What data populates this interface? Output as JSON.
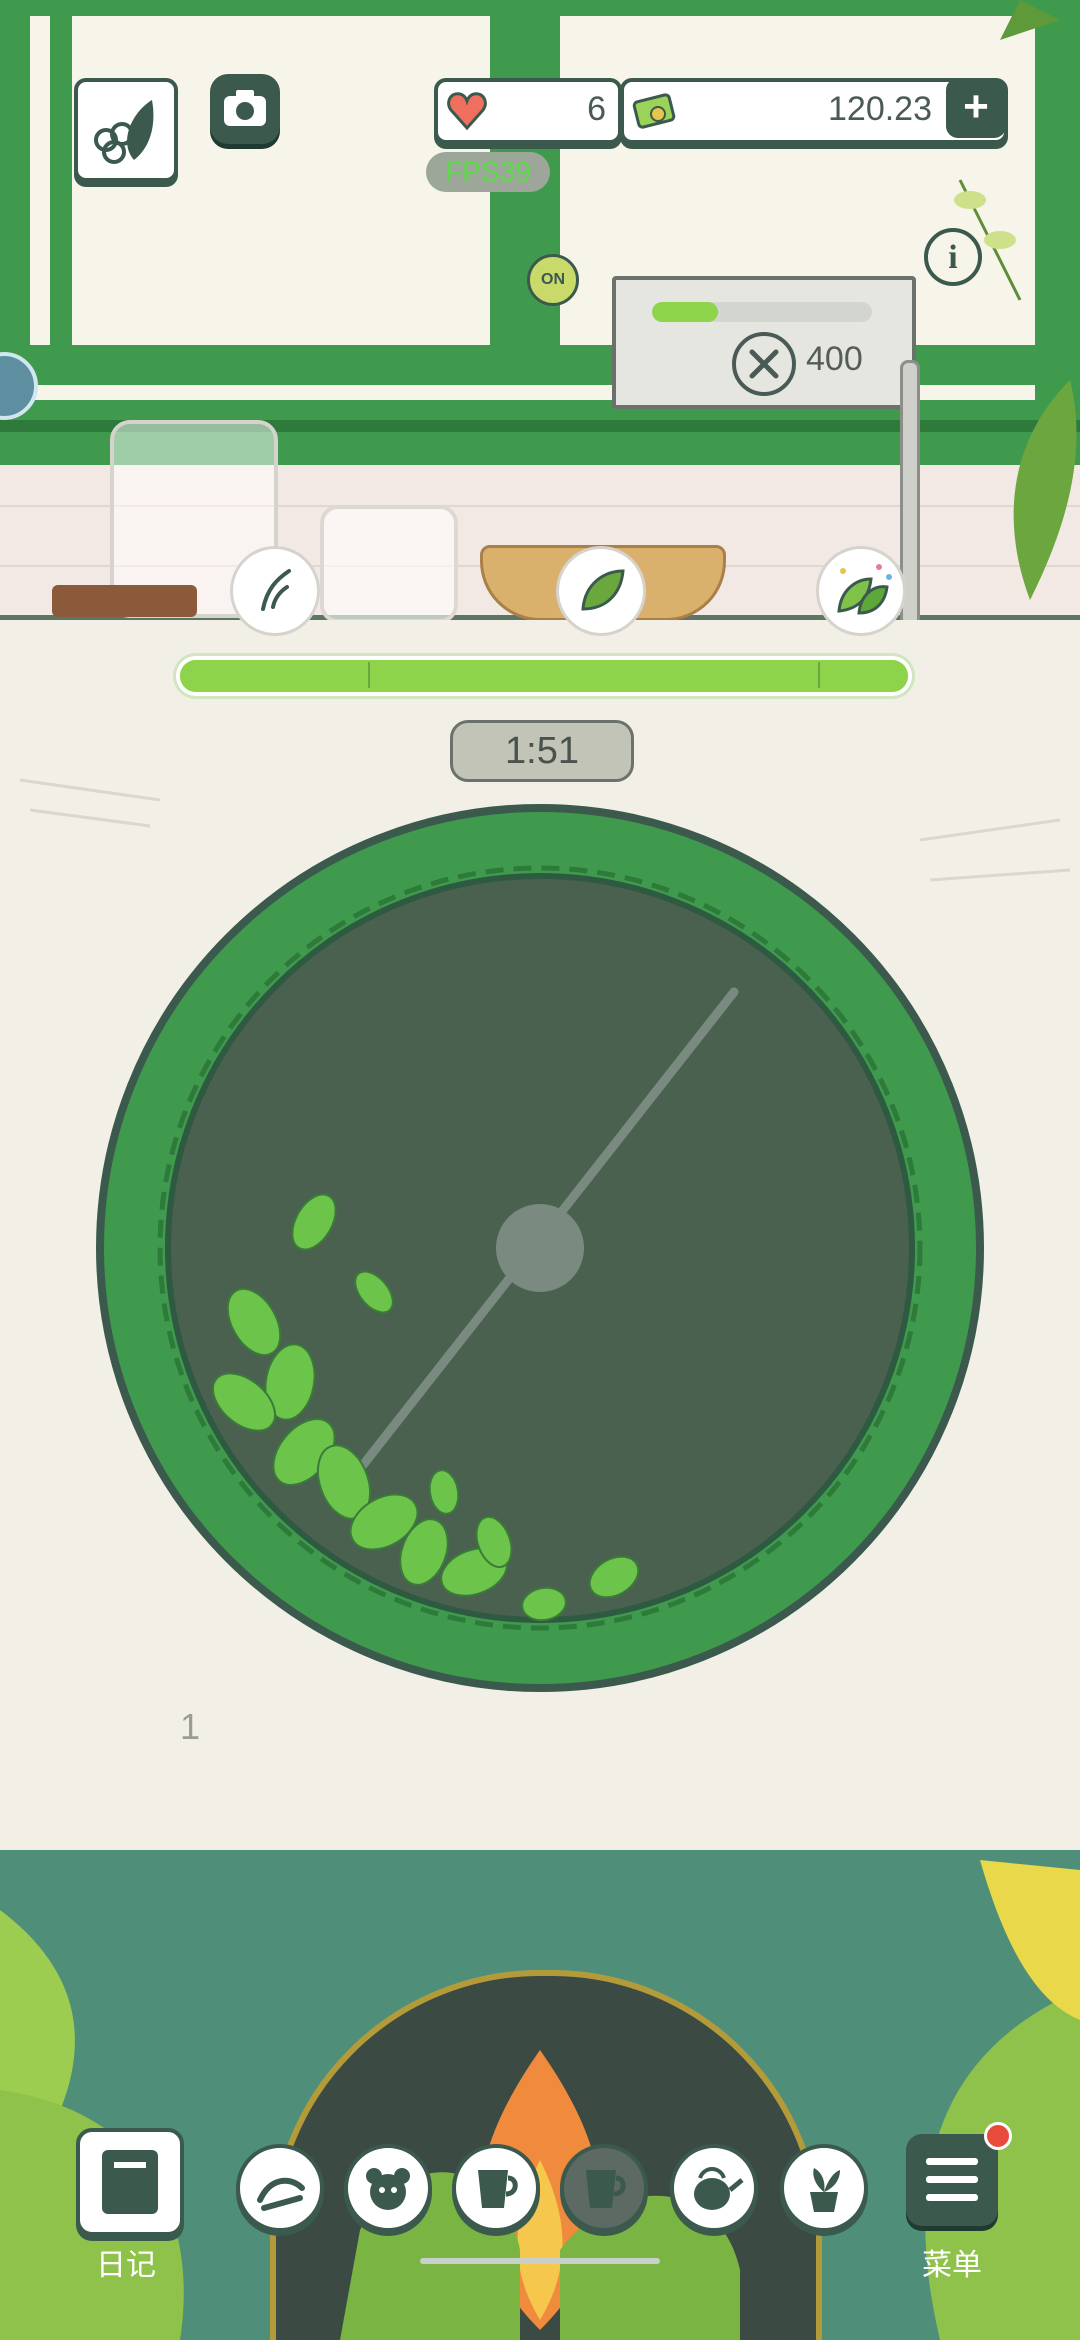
{
  "header": {
    "lives_count": "6",
    "currency_amount": "120.23",
    "fps_label": "FPS39",
    "add_label": "+"
  },
  "machine": {
    "switch_label": "ON",
    "counter_value": "400",
    "charge_fraction": 0.3
  },
  "brewing": {
    "timer": "1:51",
    "progress_fraction": 1.0,
    "stages": [
      "withered",
      "leaf",
      "sparkle"
    ]
  },
  "arena": {
    "level_number": "1"
  },
  "navigation": {
    "diary_label": "日记",
    "menu_label": "菜单",
    "tool_buttons": [
      "hand-icon",
      "bear-icon",
      "cup-icon",
      "cup-dark-icon",
      "kettle-icon",
      "plant-icon"
    ]
  },
  "colors": {
    "accent_green": "#3f9a4e",
    "progress_green": "#8ed44a",
    "dark_green": "#3b5a4d",
    "notification_red": "#e84a3c"
  }
}
